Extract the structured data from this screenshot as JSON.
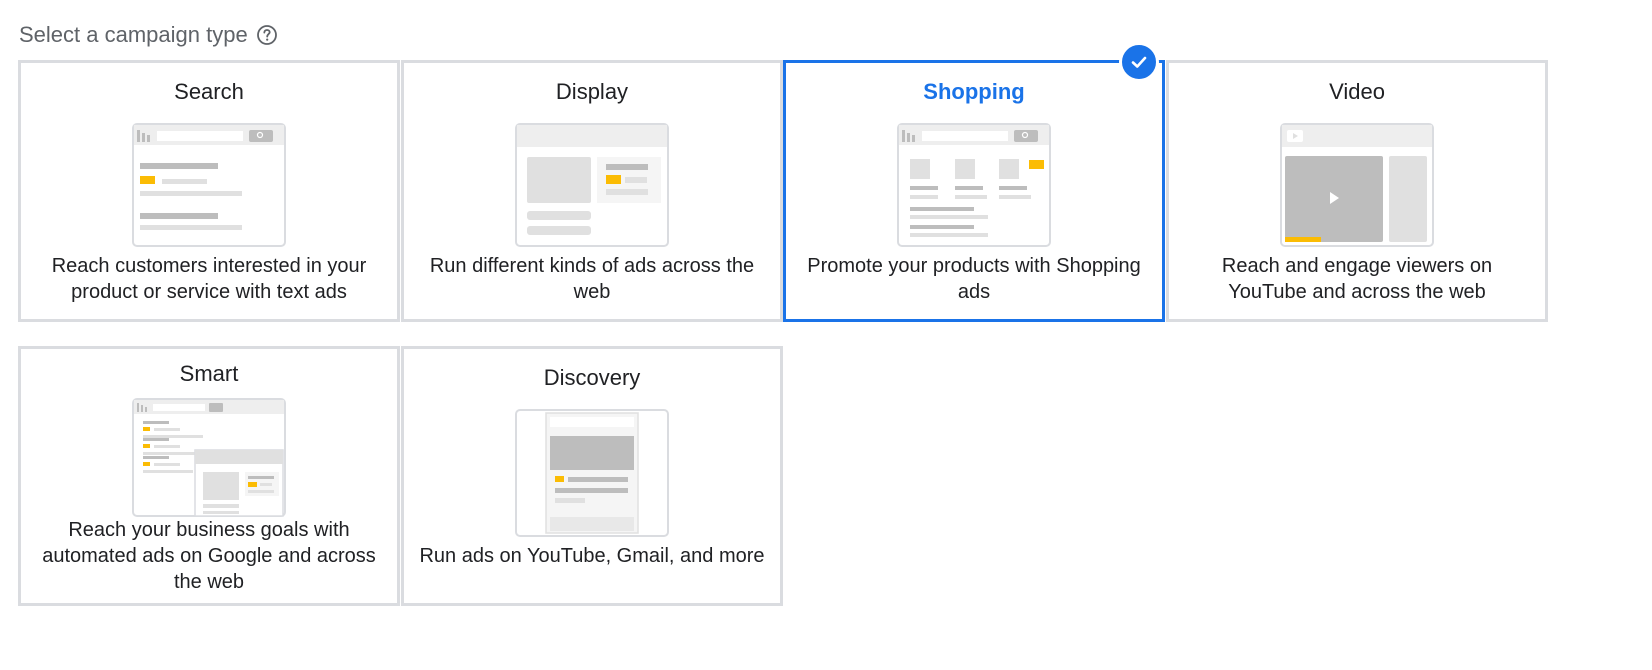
{
  "header": {
    "title": "Select a campaign type",
    "help_icon": "help-circle-icon"
  },
  "colors": {
    "accent": "#1a73e8",
    "border": "#dadce0",
    "highlight": "#fbbc04"
  },
  "selected_type": "Shopping",
  "campaign_types": [
    {
      "id": "search",
      "title": "Search",
      "description": "Reach customers interested in your product or service with text ads"
    },
    {
      "id": "display",
      "title": "Display",
      "description": "Run different kinds of ads across the web"
    },
    {
      "id": "shopping",
      "title": "Shopping",
      "description": "Promote your products with Shopping ads",
      "selected": true
    },
    {
      "id": "video",
      "title": "Video",
      "description": "Reach and engage viewers on YouTube and across the web"
    },
    {
      "id": "smart",
      "title": "Smart",
      "description": "Reach your business goals with automated ads on Google and across the web"
    },
    {
      "id": "discovery",
      "title": "Discovery",
      "description": "Run ads on YouTube, Gmail, and more"
    }
  ]
}
